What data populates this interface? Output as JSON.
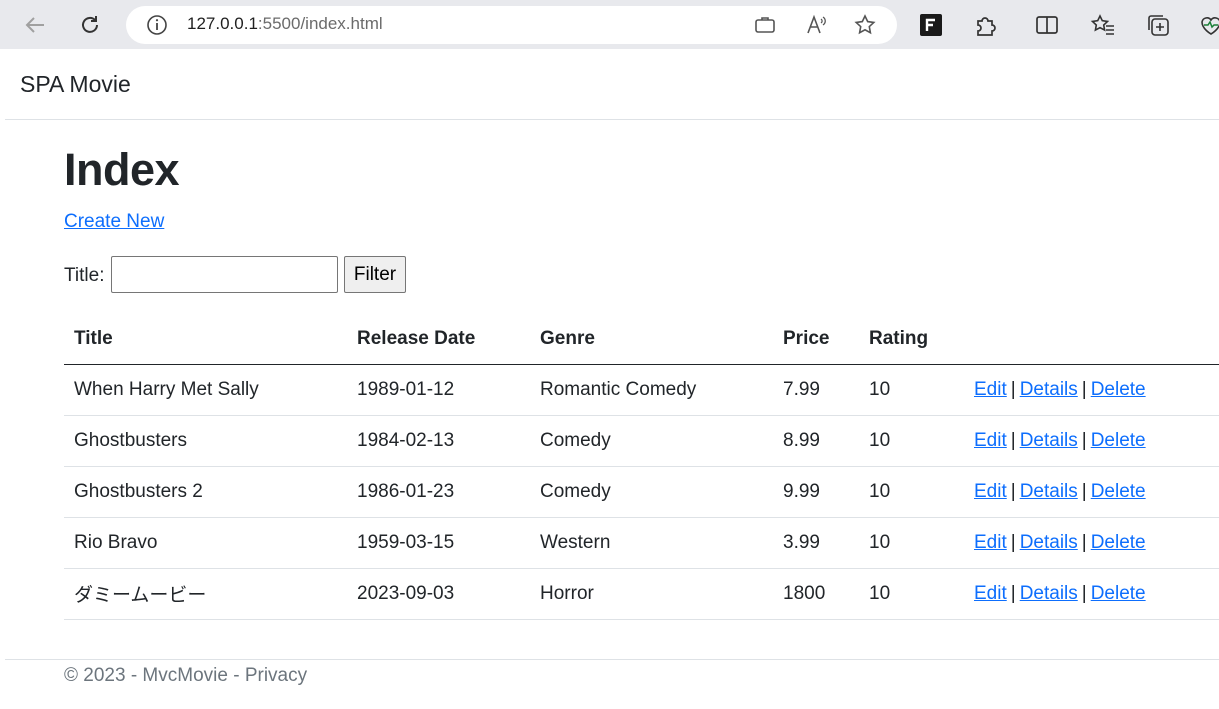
{
  "browser": {
    "address": {
      "host": "127.0.0.1",
      "rest": ":5500/index.html"
    },
    "icons": [
      "back-icon",
      "refresh-icon",
      "site-info-icon",
      "app-available-icon",
      "read-aloud-icon",
      "favorite-star-icon",
      "extension-f-icon",
      "extensions-icon",
      "split-screen-icon",
      "favorites-icon",
      "collections-icon",
      "performance-icon"
    ]
  },
  "navbar": {
    "brand": "SPA Movie"
  },
  "main": {
    "title": "Index",
    "create_link": "Create New",
    "filter": {
      "label": "Title:",
      "value": "",
      "button": "Filter"
    }
  },
  "table": {
    "headers": [
      "Title",
      "Release Date",
      "Genre",
      "Price",
      "Rating",
      ""
    ],
    "rows": [
      [
        "When Harry Met Sally",
        "1989-01-12",
        "Romantic Comedy",
        "7.99",
        "10"
      ],
      [
        "Ghostbusters",
        "1984-02-13",
        "Comedy",
        "8.99",
        "10"
      ],
      [
        "Ghostbusters 2",
        "1986-01-23",
        "Comedy",
        "9.99",
        "10"
      ],
      [
        "Rio Bravo",
        "1959-03-15",
        "Western",
        "3.99",
        "10"
      ],
      [
        "ダミームービー",
        "2023-09-03",
        "Horror",
        "1800",
        "10"
      ]
    ],
    "actions": {
      "edit": "Edit",
      "details": "Details",
      "delete": "Delete",
      "separator": "|"
    }
  },
  "footer": {
    "copyright": "© 2023 - MvcMovie - ",
    "privacy": "Privacy"
  },
  "colors": {
    "link": "#0d6efd",
    "text": "#212529",
    "muted": "#6c757d",
    "chrome": "#e8e9ed"
  }
}
